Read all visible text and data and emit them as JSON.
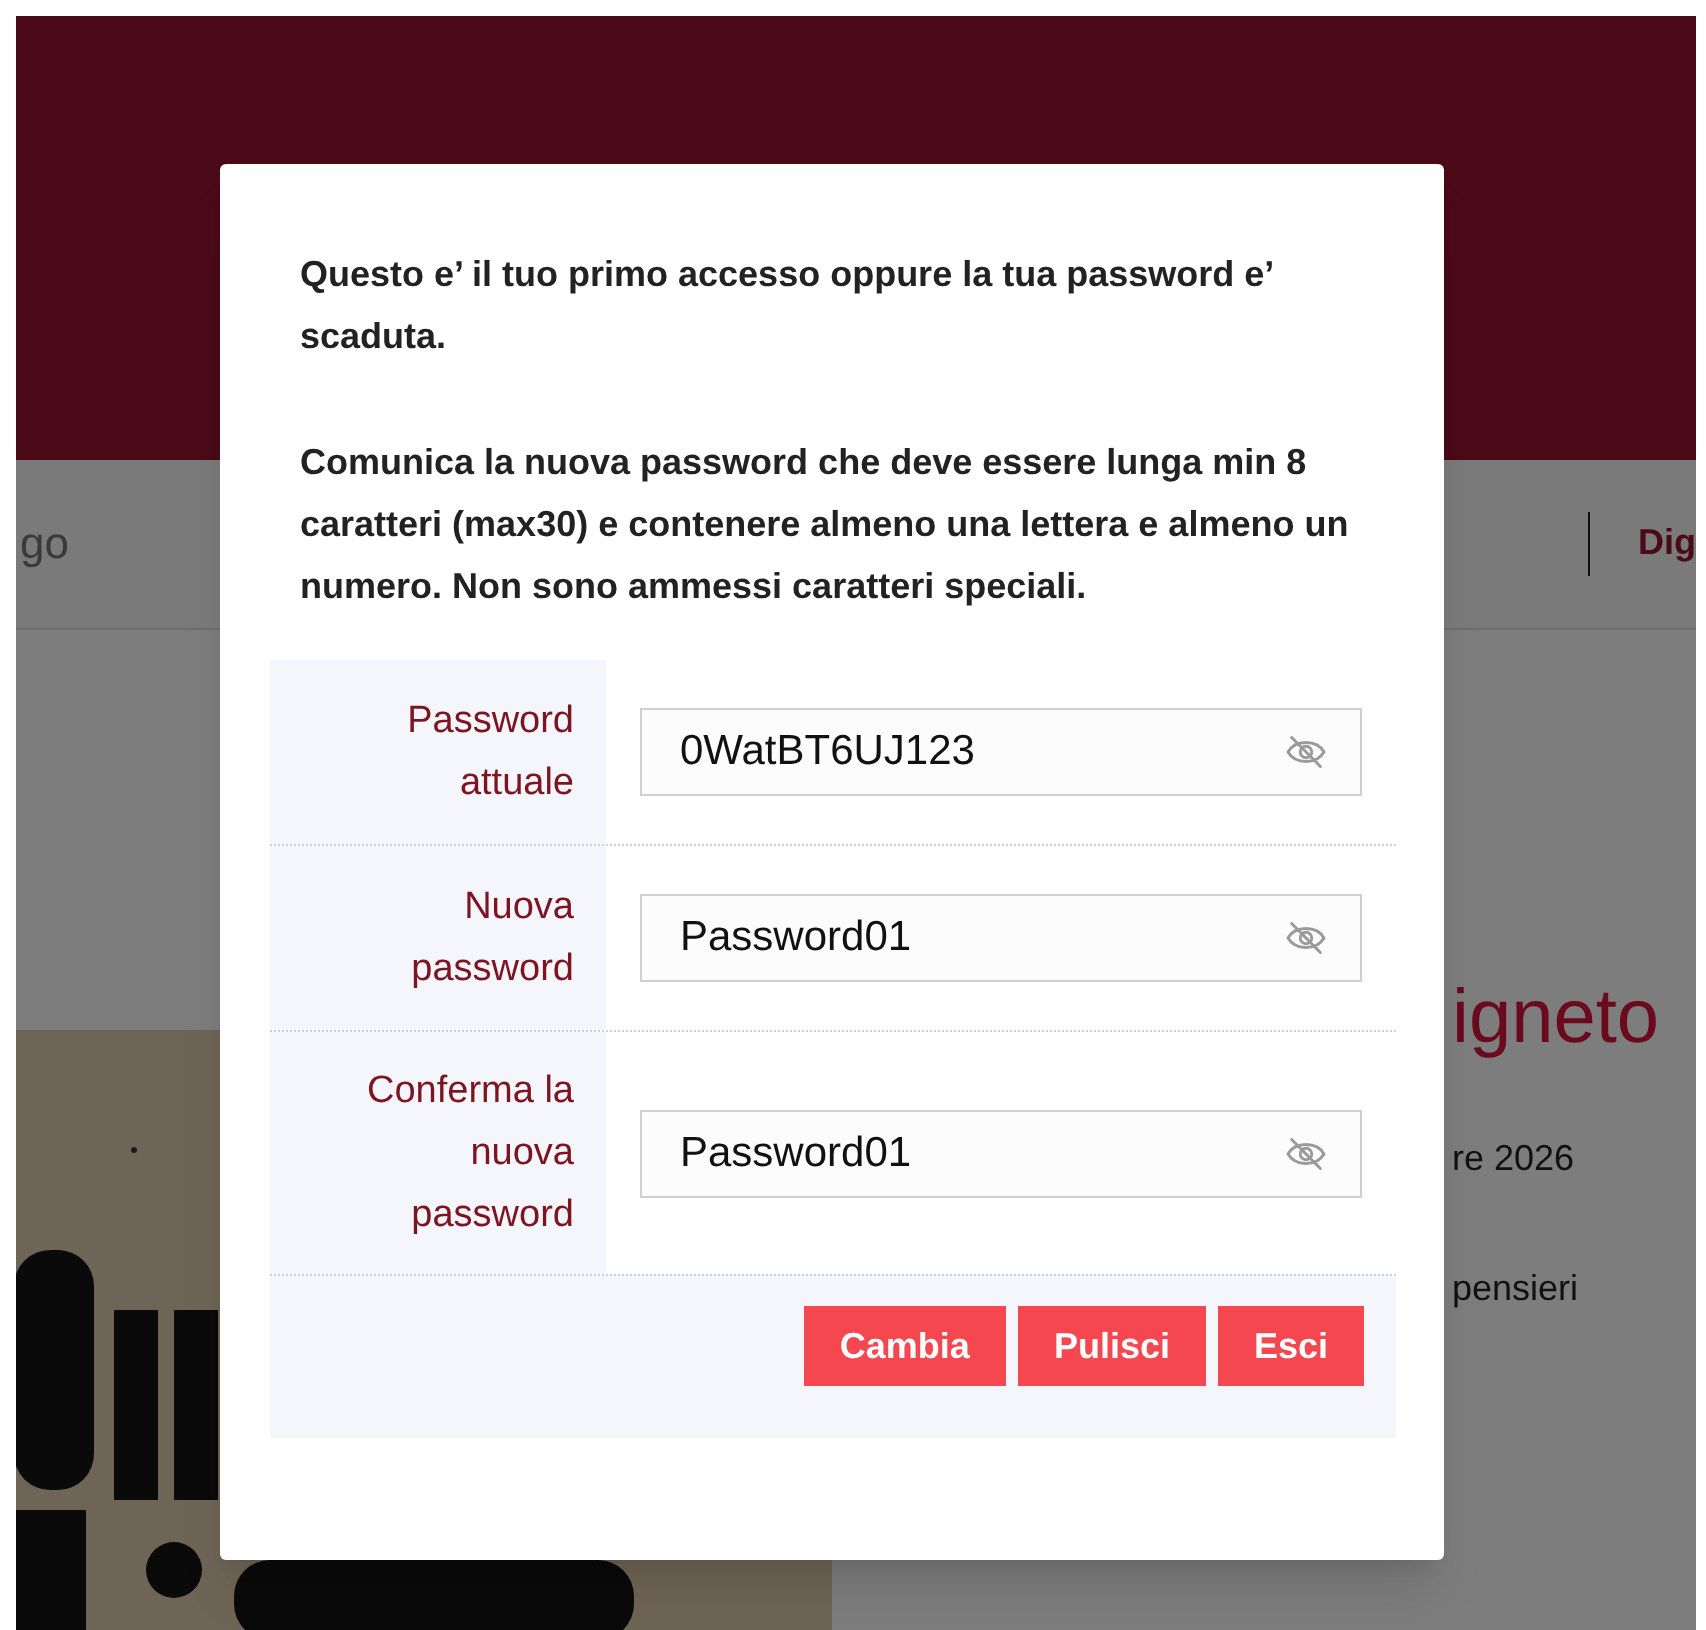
{
  "background": {
    "nav_text_left": "go",
    "nav_link": "Dig",
    "heading": "igneto",
    "date_fragment": "re 2026",
    "text_fragment": "pensieri"
  },
  "dialog": {
    "intro": "Questo e’ il tuo primo accesso oppure la tua password e’ scaduta.",
    "rules": "Comunica la nuova password che deve essere lunga min 8 caratteri (max30) e contenere almeno una lettera e almeno un numero. Non sono ammessi caratteri speciali.",
    "fields": [
      {
        "label": "Password attuale",
        "value": "0WatBT6UJ123"
      },
      {
        "label": "Nuova password",
        "value": "Password01"
      },
      {
        "label": "Conferma la nuova password",
        "value": "Password01"
      }
    ],
    "buttons": [
      "Cambia",
      "Pulisci",
      "Esci"
    ]
  }
}
